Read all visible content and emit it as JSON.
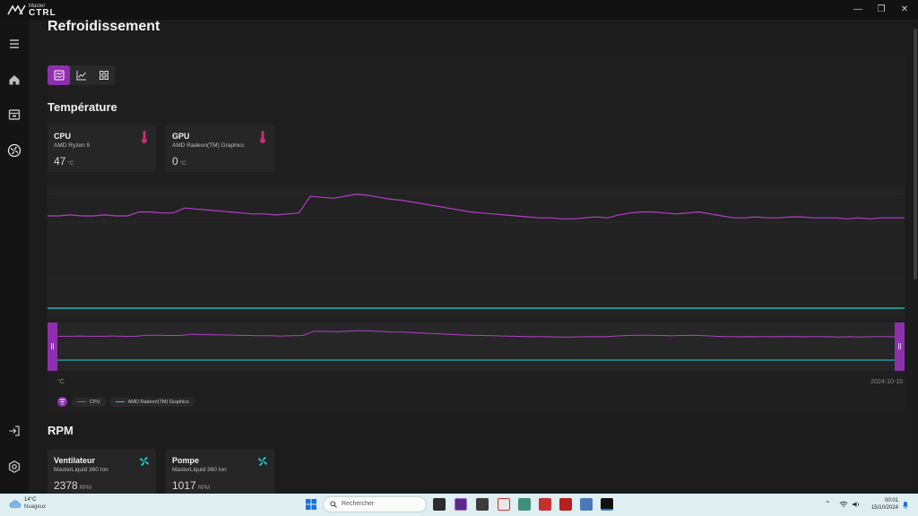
{
  "app": {
    "brand_top": "Master",
    "brand_bottom": "CTRL"
  },
  "window_controls": {
    "minimize": "—",
    "maximize": "❐",
    "close": "✕"
  },
  "page": {
    "title": "Refroidissement"
  },
  "temperature": {
    "title": "Température",
    "cards": [
      {
        "title": "CPU",
        "subtitle": "AMD Ryzen 9",
        "value": "47",
        "unit": "°C"
      },
      {
        "title": "GPU",
        "subtitle": "AMD Radeon(TM) Graphics",
        "value": "0",
        "unit": "°C"
      }
    ]
  },
  "chart_data": {
    "type": "line",
    "ylabel": "°C",
    "x_label_right": "2024-10-15",
    "series": [
      {
        "name": "CPU",
        "color": "#b23fc4",
        "values": [
          47,
          47,
          47.5,
          47,
          47,
          47.5,
          47,
          47,
          49,
          49,
          48.5,
          48.5,
          51,
          50.5,
          50,
          49.5,
          49,
          48.5,
          48,
          48,
          47.5,
          48,
          48.5,
          57,
          56.5,
          56,
          57,
          58,
          57.5,
          56.5,
          55.5,
          55,
          54,
          53,
          52,
          51,
          50,
          49,
          48.5,
          48,
          47.5,
          47,
          46.5,
          46,
          46,
          45.5,
          45.5,
          46,
          46.5,
          46,
          47.5,
          48.5,
          49,
          49,
          48.5,
          48,
          48.5,
          49,
          48,
          47,
          46,
          46,
          46.5,
          46,
          46,
          46.5,
          46.5,
          46,
          46,
          46,
          45.5,
          46,
          45.5,
          46,
          46,
          46
        ]
      },
      {
        "name": "AMD Radeon(TM) Graphics",
        "color": "#1ed1d6",
        "values": [
          0,
          0,
          0,
          0,
          0,
          0,
          0,
          0,
          0,
          0,
          0,
          0,
          0,
          0,
          0,
          0,
          0,
          0,
          0,
          0,
          0,
          0,
          0,
          0,
          0,
          0,
          0,
          0,
          0,
          0,
          0,
          0,
          0,
          0,
          0,
          0,
          0,
          0,
          0,
          0,
          0,
          0,
          0,
          0,
          0,
          0,
          0,
          0,
          0,
          0,
          0,
          0,
          0,
          0,
          0,
          0,
          0,
          0,
          0,
          0,
          0,
          0,
          0,
          0,
          0,
          0,
          0,
          0,
          0,
          0,
          0,
          0,
          0,
          0,
          0,
          0
        ]
      }
    ]
  },
  "rpm": {
    "title": "RPM",
    "cards": [
      {
        "title": "Ventilateur",
        "subtitle": "MasterLiquid 360 Ion",
        "value": "2378",
        "unit": "RPM"
      },
      {
        "title": "Pompe",
        "subtitle": "MasterLiquid 360 Ion",
        "value": "1017",
        "unit": "RPM"
      }
    ]
  },
  "taskbar": {
    "weather_temp": "14°C",
    "weather_desc": "Nuageux",
    "search_placeholder": "Rechercher",
    "time": "00:01",
    "date": "15/10/2024"
  },
  "colors": {
    "accent": "#8e2fae",
    "cpu_line": "#b23fc4",
    "gpu_line": "#1ed1d6",
    "thermo_icon": "#c2306e",
    "fan_icon": "#1ed1d6"
  }
}
